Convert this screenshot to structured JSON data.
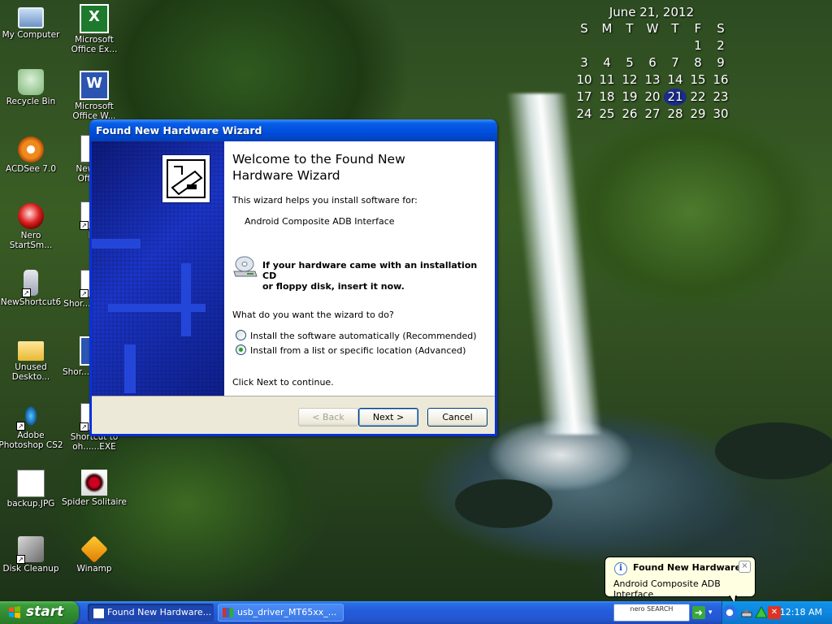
{
  "desktop": {
    "icons": [
      {
        "label": "My Computer",
        "icon": "my-computer-icon"
      },
      {
        "label": "Recycle Bin",
        "icon": "recycle-bin-icon"
      },
      {
        "label": "ACDSee 7.0",
        "icon": "acdsee-icon"
      },
      {
        "label": "Nero StartSm...",
        "icon": "nero-icon"
      },
      {
        "label": "NewShortcut6",
        "icon": "phone-icon"
      },
      {
        "label": "Unused Deskto...",
        "icon": "folder-icon"
      },
      {
        "label": "Adobe Photoshop CS2",
        "icon": "photoshop-icon"
      },
      {
        "label": "backup.JPG",
        "icon": "jpg-file-icon"
      },
      {
        "label": "Disk Cleanup",
        "icon": "disk-cleanup-icon"
      },
      {
        "label": "Microsoft Office Ex...",
        "icon": "excel-icon"
      },
      {
        "label": "Microsoft Office W...",
        "icon": "word-icon"
      },
      {
        "label": "New M... Office...",
        "icon": "office-doc-icon"
      },
      {
        "label": "P...",
        "icon": "shortcut-icon"
      },
      {
        "label": "Shor... K-Lite...",
        "icon": "klite-icon"
      },
      {
        "label": "Shor... KMPla...",
        "icon": "kmplayer-icon"
      },
      {
        "label": "Shortcut to oh......EXE",
        "icon": "exe-shortcut-icon"
      },
      {
        "label": "Spider Solitaire",
        "icon": "spider-solitaire-icon"
      },
      {
        "label": "Winamp",
        "icon": "winamp-icon"
      }
    ]
  },
  "calendar": {
    "title": "June 21, 2012",
    "weekdays": [
      "S",
      "M",
      "T",
      "W",
      "T",
      "F",
      "S"
    ],
    "weeks": [
      [
        "",
        "",
        "",
        "",
        "",
        "1",
        "2"
      ],
      [
        "3",
        "4",
        "5",
        "6",
        "7",
        "8",
        "9"
      ],
      [
        "10",
        "11",
        "12",
        "13",
        "14",
        "15",
        "16"
      ],
      [
        "17",
        "18",
        "19",
        "20",
        "21",
        "22",
        "23"
      ],
      [
        "24",
        "25",
        "26",
        "27",
        "28",
        "29",
        "30"
      ]
    ],
    "today": "21"
  },
  "wizard": {
    "window_title": "Found New Hardware Wizard",
    "heading_line1": "Welcome to the Found New",
    "heading_line2": "Hardware Wizard",
    "intro": "This wizard helps you install software for:",
    "device": "Android Composite ADB Interface",
    "cd_line1": "If your hardware came with an installation CD",
    "cd_line2": "or floppy disk, insert it now.",
    "question": "What do you want the wizard to do?",
    "options": [
      {
        "label": "Install the software automatically (Recommended)",
        "selected": false
      },
      {
        "label": "Install from a list or specific location (Advanced)",
        "selected": true
      }
    ],
    "continue_text": "Click Next to continue.",
    "buttons": {
      "back": "< Back",
      "next": "Next >",
      "cancel": "Cancel"
    }
  },
  "balloon": {
    "title": "Found New Hardware",
    "text": "Android Composite ADB Interface",
    "close": "×"
  },
  "taskbar": {
    "start_label": "start",
    "tasks": [
      {
        "label": "Found New Hardware...",
        "active": true
      },
      {
        "label": "usb_driver_MT65xx_...",
        "active": false
      }
    ],
    "nero_search": "nero SEARCH",
    "clock": "12:18 AM"
  },
  "colors": {
    "xp_blue": "#0831d9",
    "taskbar_blue": "#245ddb",
    "start_green": "#3c9c3c",
    "tray_blue": "#0c84dc",
    "balloon_bg": "#ffffe1"
  }
}
